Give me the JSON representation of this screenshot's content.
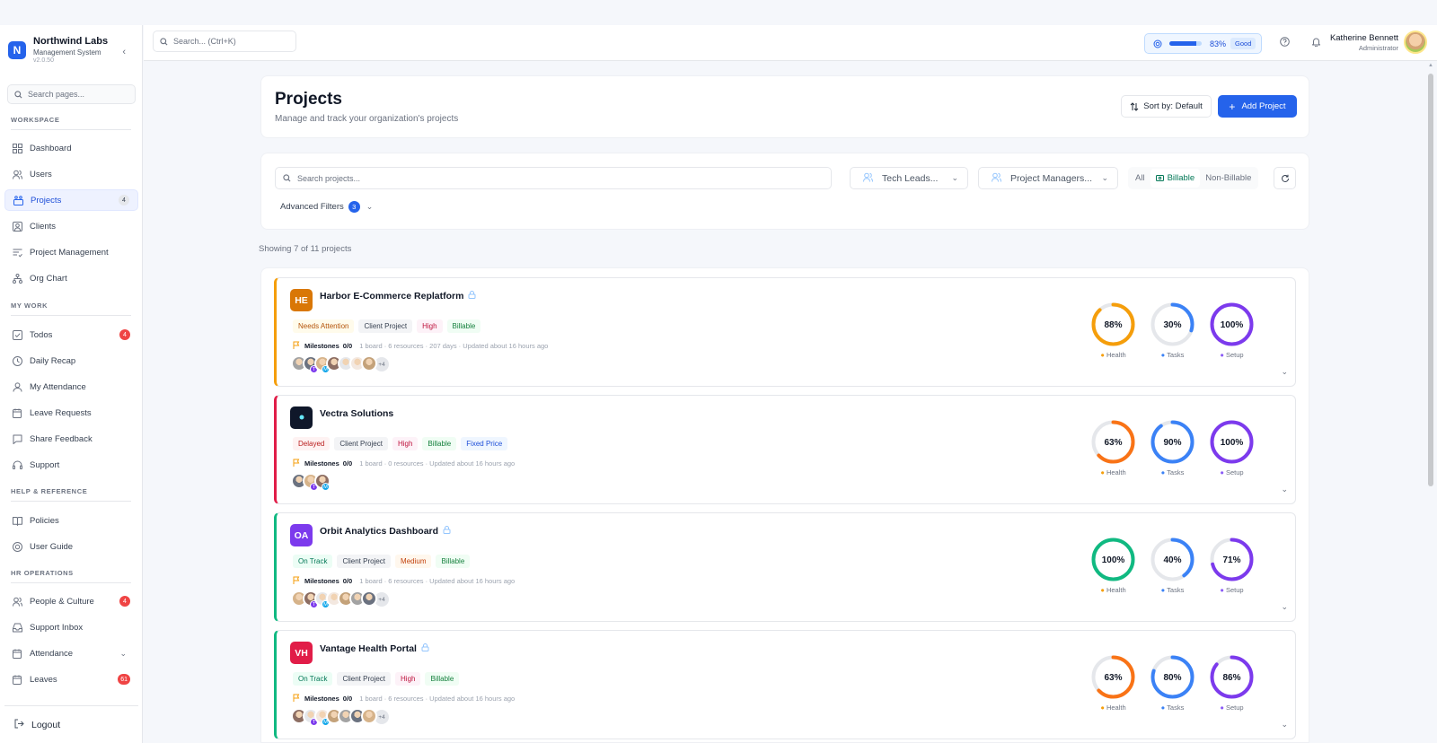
{
  "brand": {
    "name": "Northwind Labs",
    "subtitle": "Management System",
    "version": "v2.0.50",
    "logo_letter": "N"
  },
  "sidebar": {
    "search_placeholder": "Search pages...",
    "sections": {
      "workspace": "WORKSPACE",
      "my_work": "MY WORK",
      "help": "HELP & REFERENCE",
      "hr": "HR OPERATIONS"
    },
    "items": {
      "dashboard": "Dashboard",
      "users": "Users",
      "projects": "Projects",
      "projects_count": "4",
      "clients": "Clients",
      "project_management": "Project Management",
      "org_chart": "Org Chart",
      "todos": "Todos",
      "todos_count": "4",
      "daily_recap": "Daily Recap",
      "my_attendance": "My Attendance",
      "leave_requests": "Leave Requests",
      "share_feedback": "Share Feedback",
      "support": "Support",
      "policies": "Policies",
      "user_guide": "User Guide",
      "people_culture": "People & Culture",
      "people_culture_count": "4",
      "support_inbox": "Support Inbox",
      "attendance": "Attendance",
      "leaves": "Leaves",
      "leaves_count": "61"
    },
    "logout": "Logout"
  },
  "topbar": {
    "search_placeholder": "Search... (Ctrl+K)",
    "health_percent": "83%",
    "health_value": 0.83,
    "health_status": "Good",
    "user_name": "Katherine Bennett",
    "user_role": "Administrator"
  },
  "page": {
    "title": "Projects",
    "subtitle": "Manage and track your organization's projects",
    "sort_label": "Sort by: Default",
    "add_label": "Add Project"
  },
  "filters": {
    "search_placeholder": "Search projects...",
    "tech_leads": "Tech Leads...",
    "project_managers": "Project Managers...",
    "billing_all": "All",
    "billing_billable": "Billable",
    "billing_non": "Non-Billable",
    "advanced_label": "Advanced Filters",
    "advanced_count": "3"
  },
  "showing": "Showing 7 of 11 projects",
  "projects": [
    {
      "initials": "HE",
      "logo_color": "#d97706",
      "border_color": "#f59e0b",
      "name": "Harbor E-Commerce Replatform",
      "tags": [
        {
          "text": "Needs Attention",
          "cls": "t-attn"
        },
        {
          "text": "Client Project",
          "cls": "t-client"
        },
        {
          "text": "High",
          "cls": "t-high"
        },
        {
          "text": "Billable",
          "cls": "t-bill"
        }
      ],
      "milestones_label": "Milestones",
      "milestones_value": "0/0",
      "meta": "1 board · 6 resources · 207 days · Updated about 16 hours ago",
      "more": "+4",
      "health": 88,
      "health_text": "88%",
      "health_color": "#f59e0b",
      "tasks": 30,
      "tasks_text": "30%",
      "setup": 100,
      "setup_text": "100%"
    },
    {
      "initials": "",
      "logo_color": "#0f172a",
      "border_color": "#e11d48",
      "name": "Vectra Solutions",
      "tags": [
        {
          "text": "Delayed",
          "cls": "t-delay"
        },
        {
          "text": "Client Project",
          "cls": "t-client"
        },
        {
          "text": "High",
          "cls": "t-high"
        },
        {
          "text": "Billable",
          "cls": "t-bill"
        },
        {
          "text": "Fixed Price",
          "cls": "t-fixed"
        }
      ],
      "milestones_label": "Milestones",
      "milestones_value": "0/0",
      "meta": "1 board · 0 resources · Updated about 16 hours ago",
      "more": "",
      "health": 63,
      "health_text": "63%",
      "health_color": "#f97316",
      "tasks": 90,
      "tasks_text": "90%",
      "setup": 100,
      "setup_text": "100%"
    },
    {
      "initials": "OA",
      "logo_color": "#7c3aed",
      "border_color": "#10b981",
      "name": "Orbit Analytics Dashboard",
      "tags": [
        {
          "text": "On Track",
          "cls": "t-track"
        },
        {
          "text": "Client Project",
          "cls": "t-client"
        },
        {
          "text": "Medium",
          "cls": "t-med"
        },
        {
          "text": "Billable",
          "cls": "t-bill"
        }
      ],
      "milestones_label": "Milestones",
      "milestones_value": "0/0",
      "meta": "1 board · 6 resources · Updated about 16 hours ago",
      "more": "+4",
      "health": 100,
      "health_text": "100%",
      "health_color": "#10b981",
      "tasks": 40,
      "tasks_text": "40%",
      "setup": 71,
      "setup_text": "71%"
    },
    {
      "initials": "VH",
      "logo_color": "#e11d48",
      "border_color": "#10b981",
      "name": "Vantage Health Portal",
      "tags": [
        {
          "text": "On Track",
          "cls": "t-track"
        },
        {
          "text": "Client Project",
          "cls": "t-client"
        },
        {
          "text": "High",
          "cls": "t-high"
        },
        {
          "text": "Billable",
          "cls": "t-bill"
        }
      ],
      "milestones_label": "Milestones",
      "milestones_value": "0/0",
      "meta": "1 board · 6 resources · Updated about 16 hours ago",
      "more": "+4",
      "health": 63,
      "health_text": "63%",
      "health_color": "#f97316",
      "tasks": 80,
      "tasks_text": "80%",
      "setup": 86,
      "setup_text": "86%"
    }
  ],
  "ring_labels": {
    "health": "Health",
    "tasks": "Tasks",
    "setup": "Setup"
  },
  "colors": {
    "accent": "#2563eb",
    "tasks_ring": "#3b82f6",
    "setup_ring": "#7c3aed",
    "track": "#e5e7eb"
  }
}
